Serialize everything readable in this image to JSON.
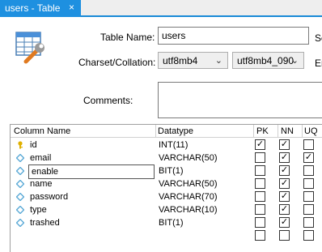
{
  "tab": {
    "title": "users - Table",
    "close": "×"
  },
  "form": {
    "table_name_label": "Table Name:",
    "table_name_value": "users",
    "schema_label_partial": "Sc",
    "charset_label": "Charset/Collation:",
    "charset_value": "utf8mb4",
    "collation_value": "utf8mb4_090",
    "engine_label_partial": "Er",
    "comments_label": "Comments:"
  },
  "grid": {
    "headers": [
      "Column Name",
      "Datatype",
      "PK",
      "NN",
      "UQ"
    ],
    "rows": [
      {
        "name": "id",
        "type": "INT(11)",
        "pk": true,
        "nn": true,
        "uq": false,
        "icon": "key-icon"
      },
      {
        "name": "email",
        "type": "VARCHAR(50)",
        "pk": false,
        "nn": true,
        "uq": true,
        "icon": "diamond-icon"
      },
      {
        "name": "enable",
        "type": "BIT(1)",
        "pk": false,
        "nn": true,
        "uq": false,
        "icon": "diamond-icon",
        "editing": true
      },
      {
        "name": "name",
        "type": "VARCHAR(50)",
        "pk": false,
        "nn": true,
        "uq": false,
        "icon": "diamond-icon"
      },
      {
        "name": "password",
        "type": "VARCHAR(70)",
        "pk": false,
        "nn": true,
        "uq": false,
        "icon": "diamond-icon"
      },
      {
        "name": "type",
        "type": "VARCHAR(10)",
        "pk": false,
        "nn": true,
        "uq": false,
        "icon": "diamond-icon"
      },
      {
        "name": "trashed",
        "type": "BIT(1)",
        "pk": false,
        "nn": true,
        "uq": false,
        "icon": "diamond-icon"
      },
      {
        "name": "",
        "type": "",
        "pk": false,
        "nn": false,
        "uq": false,
        "icon": ""
      }
    ]
  },
  "colors": {
    "tab_bg": "#1e90e0",
    "key": "#e0b000",
    "diamond": "#5aa9d6"
  }
}
